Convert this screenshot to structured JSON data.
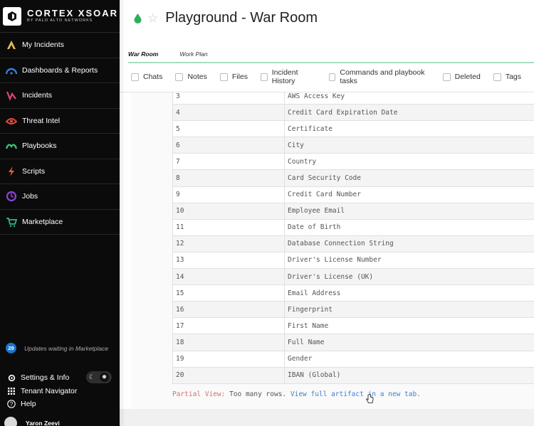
{
  "brand": {
    "name": "CORTEX XSOAR",
    "sub": "BY PALO ALTO NETWORKS"
  },
  "sidebar": {
    "items": [
      {
        "label": "My Incidents",
        "icon": "my-incidents-icon",
        "color": "#e0c15a"
      },
      {
        "label": "Dashboards & Reports",
        "icon": "dashboards-icon",
        "color": "#3b7de0"
      },
      {
        "label": "Incidents",
        "icon": "incidents-icon",
        "color": "#e0457a"
      },
      {
        "label": "Threat Intel",
        "icon": "threat-intel-icon",
        "color": "#e04a3a"
      },
      {
        "label": "Playbooks",
        "icon": "playbooks-icon",
        "color": "#3cc07a"
      },
      {
        "label": "Scripts",
        "icon": "scripts-icon",
        "color": "#e0662f"
      },
      {
        "label": "Jobs",
        "icon": "jobs-icon",
        "color": "#8e44d6"
      },
      {
        "label": "Marketplace",
        "icon": "marketplace-icon",
        "color": "#2fb88a"
      }
    ],
    "updates": {
      "count": "29",
      "text": "Updates waiting in Marketplace"
    },
    "settings_label": "Settings & Info",
    "tenant_label": "Tenant Navigator",
    "help_label": "Help",
    "user_name": "Yaron Zeevi"
  },
  "header": {
    "title": "Playground - War Room"
  },
  "tabs": [
    "War Room",
    "Work Plan"
  ],
  "filters": [
    "Chats",
    "Notes",
    "Files",
    "Incident History",
    "Commands and playbook tasks",
    "Deleted",
    "Tags"
  ],
  "artifact": {
    "rows": [
      {
        "index": "3",
        "value": "AWS Access Key"
      },
      {
        "index": "4",
        "value": "Credit Card Expiration Date"
      },
      {
        "index": "5",
        "value": "Certificate"
      },
      {
        "index": "6",
        "value": "City"
      },
      {
        "index": "7",
        "value": "Country"
      },
      {
        "index": "8",
        "value": "Card Security Code"
      },
      {
        "index": "9",
        "value": "Credit Card Number"
      },
      {
        "index": "10",
        "value": "Employee Email"
      },
      {
        "index": "11",
        "value": "Date of Birth"
      },
      {
        "index": "12",
        "value": "Database Connection String"
      },
      {
        "index": "13",
        "value": "Driver's License Number"
      },
      {
        "index": "14",
        "value": "Driver's License (UK)"
      },
      {
        "index": "15",
        "value": "Email Address"
      },
      {
        "index": "16",
        "value": "Fingerprint"
      },
      {
        "index": "17",
        "value": "First Name"
      },
      {
        "index": "18",
        "value": "Full Name"
      },
      {
        "index": "19",
        "value": "Gender"
      },
      {
        "index": "20",
        "value": "IBAN (Global)"
      }
    ],
    "partial_label": "Partial View:",
    "partial_message": " Too many rows. ",
    "partial_link": "View full artifact in a new tab."
  }
}
